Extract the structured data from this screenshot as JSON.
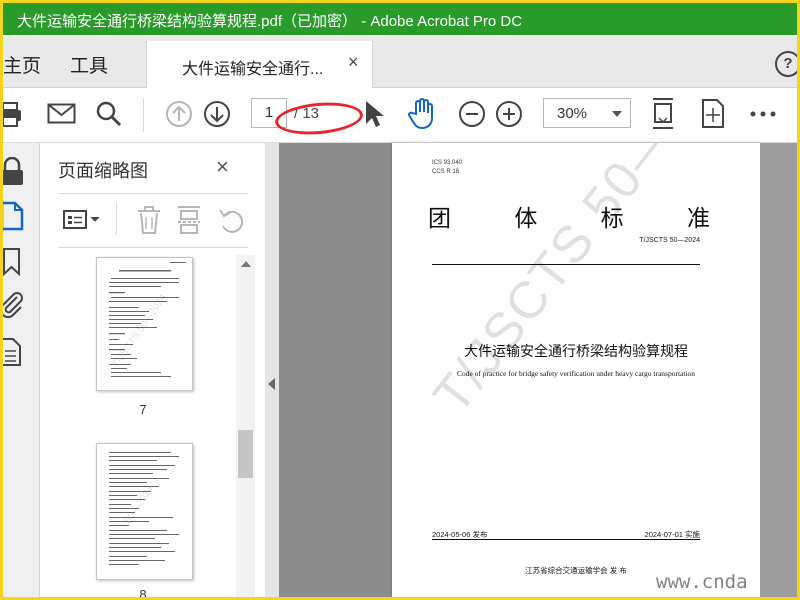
{
  "window": {
    "title": "大件运输安全通行桥梁结构验算规程.pdf（已加密） - Adobe Acrobat Pro DC",
    "title_color": "#2a9a2a",
    "border_color": "#f4d51e"
  },
  "menu": {
    "home": "主页",
    "tools": "工具",
    "doc_tab": "大件运输安全通行...",
    "close_glyph": "×",
    "help_glyph": "?"
  },
  "toolbar": {
    "icons": [
      "print-icon",
      "email-icon",
      "search-icon",
      "page-up-icon",
      "page-down-icon",
      "select-cursor-icon",
      "hand-tool-icon",
      "zoom-out-icon",
      "zoom-in-icon",
      "fit-page-icon",
      "full-screen-icon",
      "more-icon"
    ],
    "current_page": "1",
    "page_total": "/ 13",
    "zoom": "30%"
  },
  "panel": {
    "title": "页面缩略图",
    "close_glyph": "×",
    "thumbnails": [
      {
        "page": "7"
      },
      {
        "page": "8"
      }
    ]
  },
  "document": {
    "ics": "ICS 93.040",
    "ccs": "CCS R 18",
    "heading": "团 体 标 准",
    "code": "T/JSCTS 50—2024",
    "title_cn": "大件运输安全通行桥梁结构验算规程",
    "title_en": "Code of practice for bridge safety verification under heavy cargo transportation",
    "watermark": "T/JSCTS 50—2024",
    "issue_date": "2024-05-06 发布",
    "effective_date": "2024-07-01 实施",
    "publisher": "江苏省综合交通运输学会    发  布"
  },
  "overlay": {
    "site_watermark": "www.cnda",
    "annotation_color": "#e8252b"
  }
}
